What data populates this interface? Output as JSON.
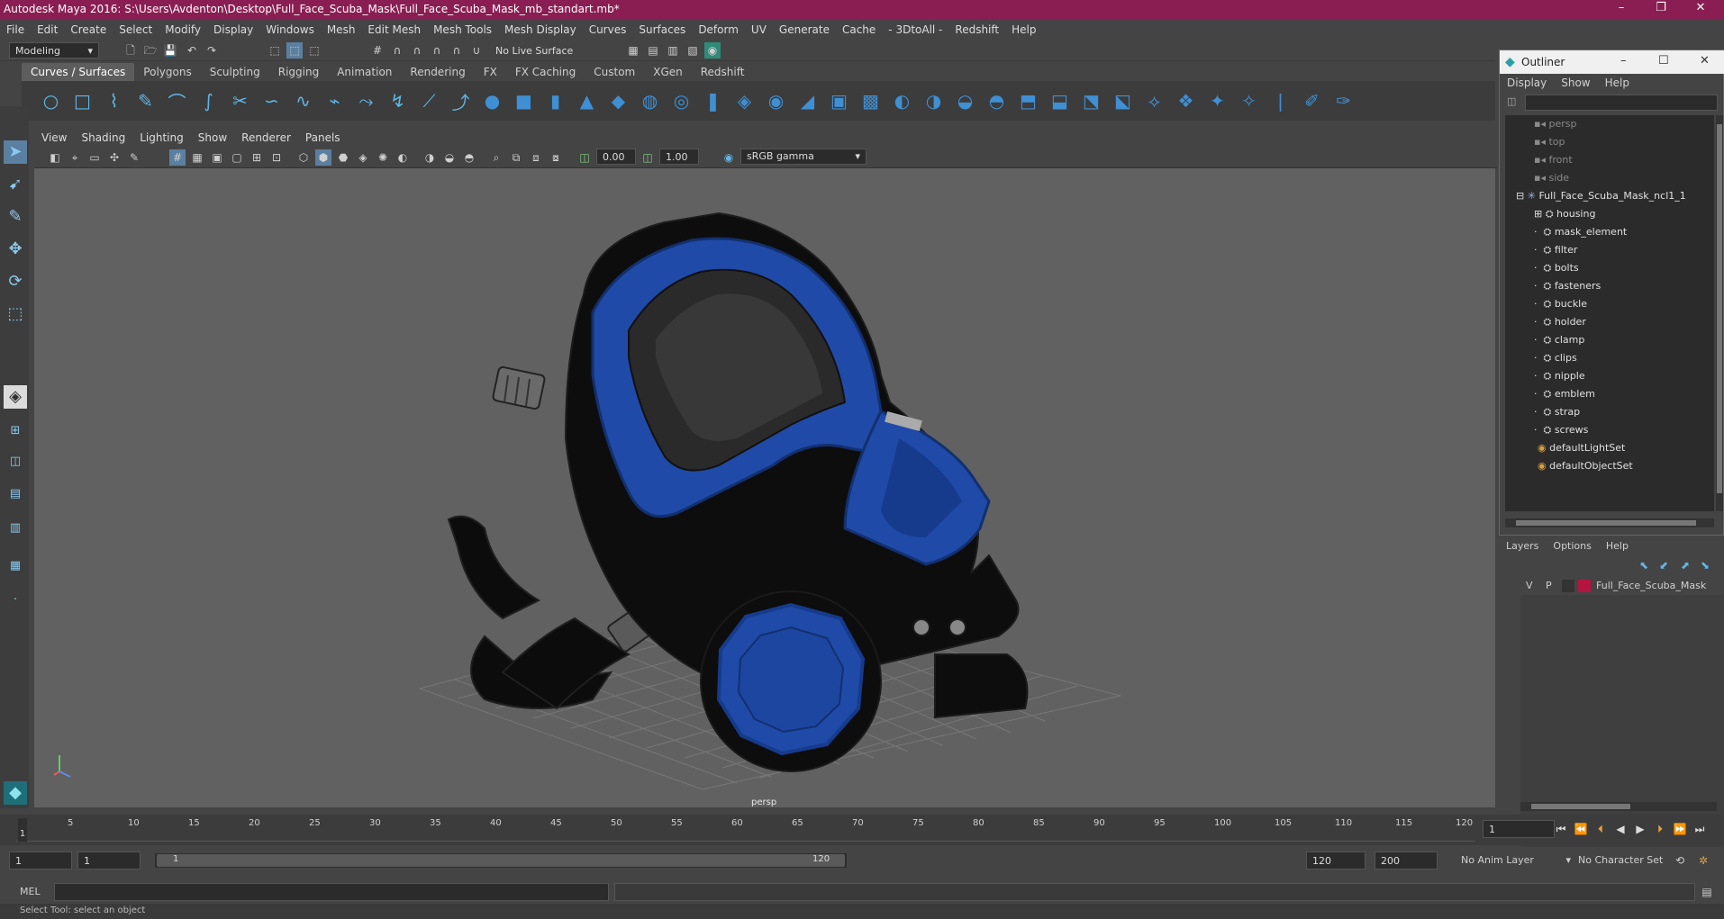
{
  "window": {
    "title": "Autodesk Maya 2016: S:\\Users\\Avdenton\\Desktop\\Full_Face_Scuba_Mask\\Full_Face_Scuba_Mask_mb_standart.mb*"
  },
  "menubar": [
    "File",
    "Edit",
    "Create",
    "Select",
    "Modify",
    "Display",
    "Windows",
    "Mesh",
    "Edit Mesh",
    "Mesh Tools",
    "Mesh Display",
    "Curves",
    "Surfaces",
    "Deform",
    "UV",
    "Generate",
    "Cache",
    "- 3DtoAll -",
    "Redshift",
    "Help"
  ],
  "statusline": {
    "mode": "Modeling",
    "live_surface": "No Live Surface"
  },
  "shelf_tabs": [
    "Curves / Surfaces",
    "Polygons",
    "Sculpting",
    "Rigging",
    "Animation",
    "Rendering",
    "FX",
    "FX Caching",
    "Custom",
    "XGen",
    "Redshift"
  ],
  "viewport": {
    "menus": [
      "View",
      "Shading",
      "Lighting",
      "Show",
      "Renderer",
      "Panels"
    ],
    "exposure": "0.00",
    "gamma": "1.00",
    "color_space": "sRGB gamma",
    "camera_label": "persp",
    "colors": {
      "mask_blue": "#1f4aa8",
      "mask_black": "#0d0d0d",
      "background": "#616161"
    }
  },
  "outliner": {
    "title": "Outliner",
    "menus": [
      "Display",
      "Show",
      "Help"
    ],
    "cameras": [
      "persp",
      "top",
      "front",
      "side"
    ],
    "root": "Full_Face_Scuba_Mask_ncl1_1",
    "children": [
      "housing",
      "mask_element",
      "filter",
      "bolts",
      "fasteners",
      "buckle",
      "holder",
      "clamp",
      "clips",
      "nipple",
      "emblem",
      "strap",
      "screws"
    ],
    "sets": [
      "defaultLightSet",
      "defaultObjectSet"
    ]
  },
  "layers": {
    "menus": [
      "Layers",
      "Options",
      "Help"
    ],
    "layer": {
      "v": "V",
      "p": "P",
      "name": "Full_Face_Scuba_Mask",
      "color": "#b3153f"
    }
  },
  "timeline": {
    "ticks": [
      "5",
      "10",
      "15",
      "20",
      "25",
      "30",
      "35",
      "40",
      "45",
      "50",
      "55",
      "60",
      "65",
      "70",
      "75",
      "80",
      "85",
      "90",
      "95",
      "100",
      "105",
      "110",
      "115",
      "120"
    ],
    "current_marker": "1",
    "current_frame": "1"
  },
  "range": {
    "start": "1",
    "start2": "1",
    "slider_start": "1",
    "slider_end": "120",
    "end": "120",
    "end2": "200",
    "anim_layer": "No Anim Layer",
    "character_set": "No Character Set"
  },
  "cmdline": {
    "label": "MEL"
  },
  "helpline": {
    "text": "Select Tool: select an object"
  }
}
